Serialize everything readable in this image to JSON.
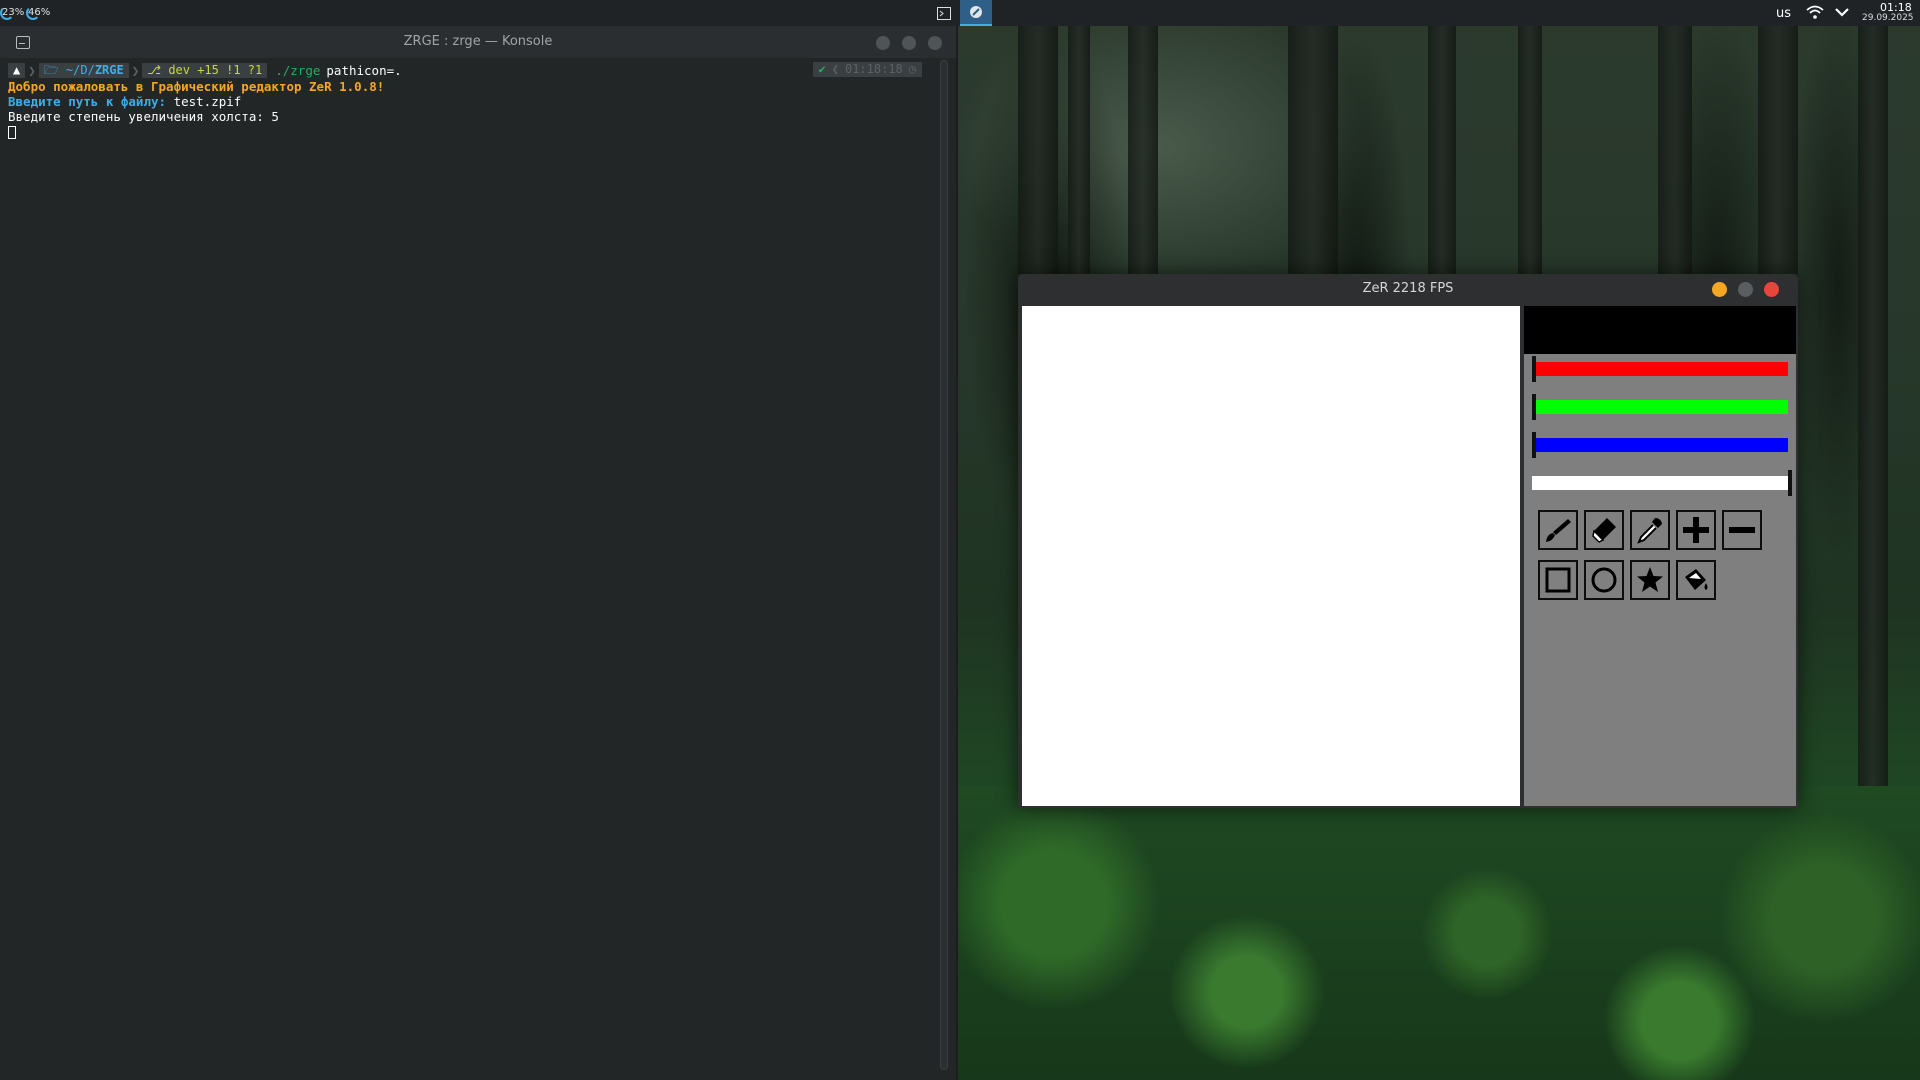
{
  "topbar": {
    "cpu": "23%",
    "mem": "46%",
    "keyboard_layout": "us",
    "time": "01:18",
    "date": "29.09.2025"
  },
  "konsole": {
    "title": "ZRGE : zrge — Konsole",
    "prompt": {
      "path_home": "~",
      "path_mid": "D",
      "path_dir": "ZRGE",
      "git": "dev +15 !1 ?1",
      "command": "./zrge",
      "args": "pathicon=.",
      "rtime": "01:18:18"
    },
    "lines": {
      "welcome": "Добро пожаловать в Графический редактор ZeR 1.0.8!",
      "path_label": "Введите путь к файлу:",
      "path_value": "test.zpif",
      "scale_line": "Введите степень увеличения холста: 5"
    }
  },
  "zer": {
    "title": "ZeR 2218 FPS",
    "colors": {
      "preview": "#000000",
      "red_slider": "#ff0000",
      "green_slider": "#00ff00",
      "blue_slider": "#0000ff",
      "alpha_slider": "#ffffff"
    },
    "slider_levels": {
      "red": 0.0,
      "green": 0.0,
      "blue": 0.0,
      "alpha": 1.0
    },
    "tools_row1": [
      "brush-icon",
      "eraser-icon",
      "eyedropper-icon",
      "plus-icon",
      "minus-icon"
    ],
    "tools_row2": [
      "rectangle-icon",
      "circle-icon",
      "star-icon",
      "fill-bucket-icon"
    ]
  }
}
